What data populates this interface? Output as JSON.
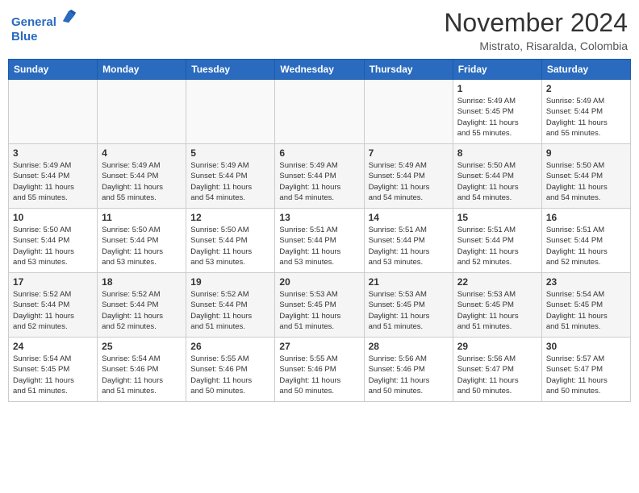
{
  "header": {
    "logo_line1": "General",
    "logo_line2": "Blue",
    "month": "November 2024",
    "location": "Mistrato, Risaralda, Colombia"
  },
  "days_of_week": [
    "Sunday",
    "Monday",
    "Tuesday",
    "Wednesday",
    "Thursday",
    "Friday",
    "Saturday"
  ],
  "weeks": [
    [
      {
        "day": "",
        "info": ""
      },
      {
        "day": "",
        "info": ""
      },
      {
        "day": "",
        "info": ""
      },
      {
        "day": "",
        "info": ""
      },
      {
        "day": "",
        "info": ""
      },
      {
        "day": "1",
        "info": "Sunrise: 5:49 AM\nSunset: 5:45 PM\nDaylight: 11 hours\nand 55 minutes."
      },
      {
        "day": "2",
        "info": "Sunrise: 5:49 AM\nSunset: 5:44 PM\nDaylight: 11 hours\nand 55 minutes."
      }
    ],
    [
      {
        "day": "3",
        "info": "Sunrise: 5:49 AM\nSunset: 5:44 PM\nDaylight: 11 hours\nand 55 minutes."
      },
      {
        "day": "4",
        "info": "Sunrise: 5:49 AM\nSunset: 5:44 PM\nDaylight: 11 hours\nand 55 minutes."
      },
      {
        "day": "5",
        "info": "Sunrise: 5:49 AM\nSunset: 5:44 PM\nDaylight: 11 hours\nand 54 minutes."
      },
      {
        "day": "6",
        "info": "Sunrise: 5:49 AM\nSunset: 5:44 PM\nDaylight: 11 hours\nand 54 minutes."
      },
      {
        "day": "7",
        "info": "Sunrise: 5:49 AM\nSunset: 5:44 PM\nDaylight: 11 hours\nand 54 minutes."
      },
      {
        "day": "8",
        "info": "Sunrise: 5:50 AM\nSunset: 5:44 PM\nDaylight: 11 hours\nand 54 minutes."
      },
      {
        "day": "9",
        "info": "Sunrise: 5:50 AM\nSunset: 5:44 PM\nDaylight: 11 hours\nand 54 minutes."
      }
    ],
    [
      {
        "day": "10",
        "info": "Sunrise: 5:50 AM\nSunset: 5:44 PM\nDaylight: 11 hours\nand 53 minutes."
      },
      {
        "day": "11",
        "info": "Sunrise: 5:50 AM\nSunset: 5:44 PM\nDaylight: 11 hours\nand 53 minutes."
      },
      {
        "day": "12",
        "info": "Sunrise: 5:50 AM\nSunset: 5:44 PM\nDaylight: 11 hours\nand 53 minutes."
      },
      {
        "day": "13",
        "info": "Sunrise: 5:51 AM\nSunset: 5:44 PM\nDaylight: 11 hours\nand 53 minutes."
      },
      {
        "day": "14",
        "info": "Sunrise: 5:51 AM\nSunset: 5:44 PM\nDaylight: 11 hours\nand 53 minutes."
      },
      {
        "day": "15",
        "info": "Sunrise: 5:51 AM\nSunset: 5:44 PM\nDaylight: 11 hours\nand 52 minutes."
      },
      {
        "day": "16",
        "info": "Sunrise: 5:51 AM\nSunset: 5:44 PM\nDaylight: 11 hours\nand 52 minutes."
      }
    ],
    [
      {
        "day": "17",
        "info": "Sunrise: 5:52 AM\nSunset: 5:44 PM\nDaylight: 11 hours\nand 52 minutes."
      },
      {
        "day": "18",
        "info": "Sunrise: 5:52 AM\nSunset: 5:44 PM\nDaylight: 11 hours\nand 52 minutes."
      },
      {
        "day": "19",
        "info": "Sunrise: 5:52 AM\nSunset: 5:44 PM\nDaylight: 11 hours\nand 51 minutes."
      },
      {
        "day": "20",
        "info": "Sunrise: 5:53 AM\nSunset: 5:45 PM\nDaylight: 11 hours\nand 51 minutes."
      },
      {
        "day": "21",
        "info": "Sunrise: 5:53 AM\nSunset: 5:45 PM\nDaylight: 11 hours\nand 51 minutes."
      },
      {
        "day": "22",
        "info": "Sunrise: 5:53 AM\nSunset: 5:45 PM\nDaylight: 11 hours\nand 51 minutes."
      },
      {
        "day": "23",
        "info": "Sunrise: 5:54 AM\nSunset: 5:45 PM\nDaylight: 11 hours\nand 51 minutes."
      }
    ],
    [
      {
        "day": "24",
        "info": "Sunrise: 5:54 AM\nSunset: 5:45 PM\nDaylight: 11 hours\nand 51 minutes."
      },
      {
        "day": "25",
        "info": "Sunrise: 5:54 AM\nSunset: 5:46 PM\nDaylight: 11 hours\nand 51 minutes."
      },
      {
        "day": "26",
        "info": "Sunrise: 5:55 AM\nSunset: 5:46 PM\nDaylight: 11 hours\nand 50 minutes."
      },
      {
        "day": "27",
        "info": "Sunrise: 5:55 AM\nSunset: 5:46 PM\nDaylight: 11 hours\nand 50 minutes."
      },
      {
        "day": "28",
        "info": "Sunrise: 5:56 AM\nSunset: 5:46 PM\nDaylight: 11 hours\nand 50 minutes."
      },
      {
        "day": "29",
        "info": "Sunrise: 5:56 AM\nSunset: 5:47 PM\nDaylight: 11 hours\nand 50 minutes."
      },
      {
        "day": "30",
        "info": "Sunrise: 5:57 AM\nSunset: 5:47 PM\nDaylight: 11 hours\nand 50 minutes."
      }
    ]
  ]
}
